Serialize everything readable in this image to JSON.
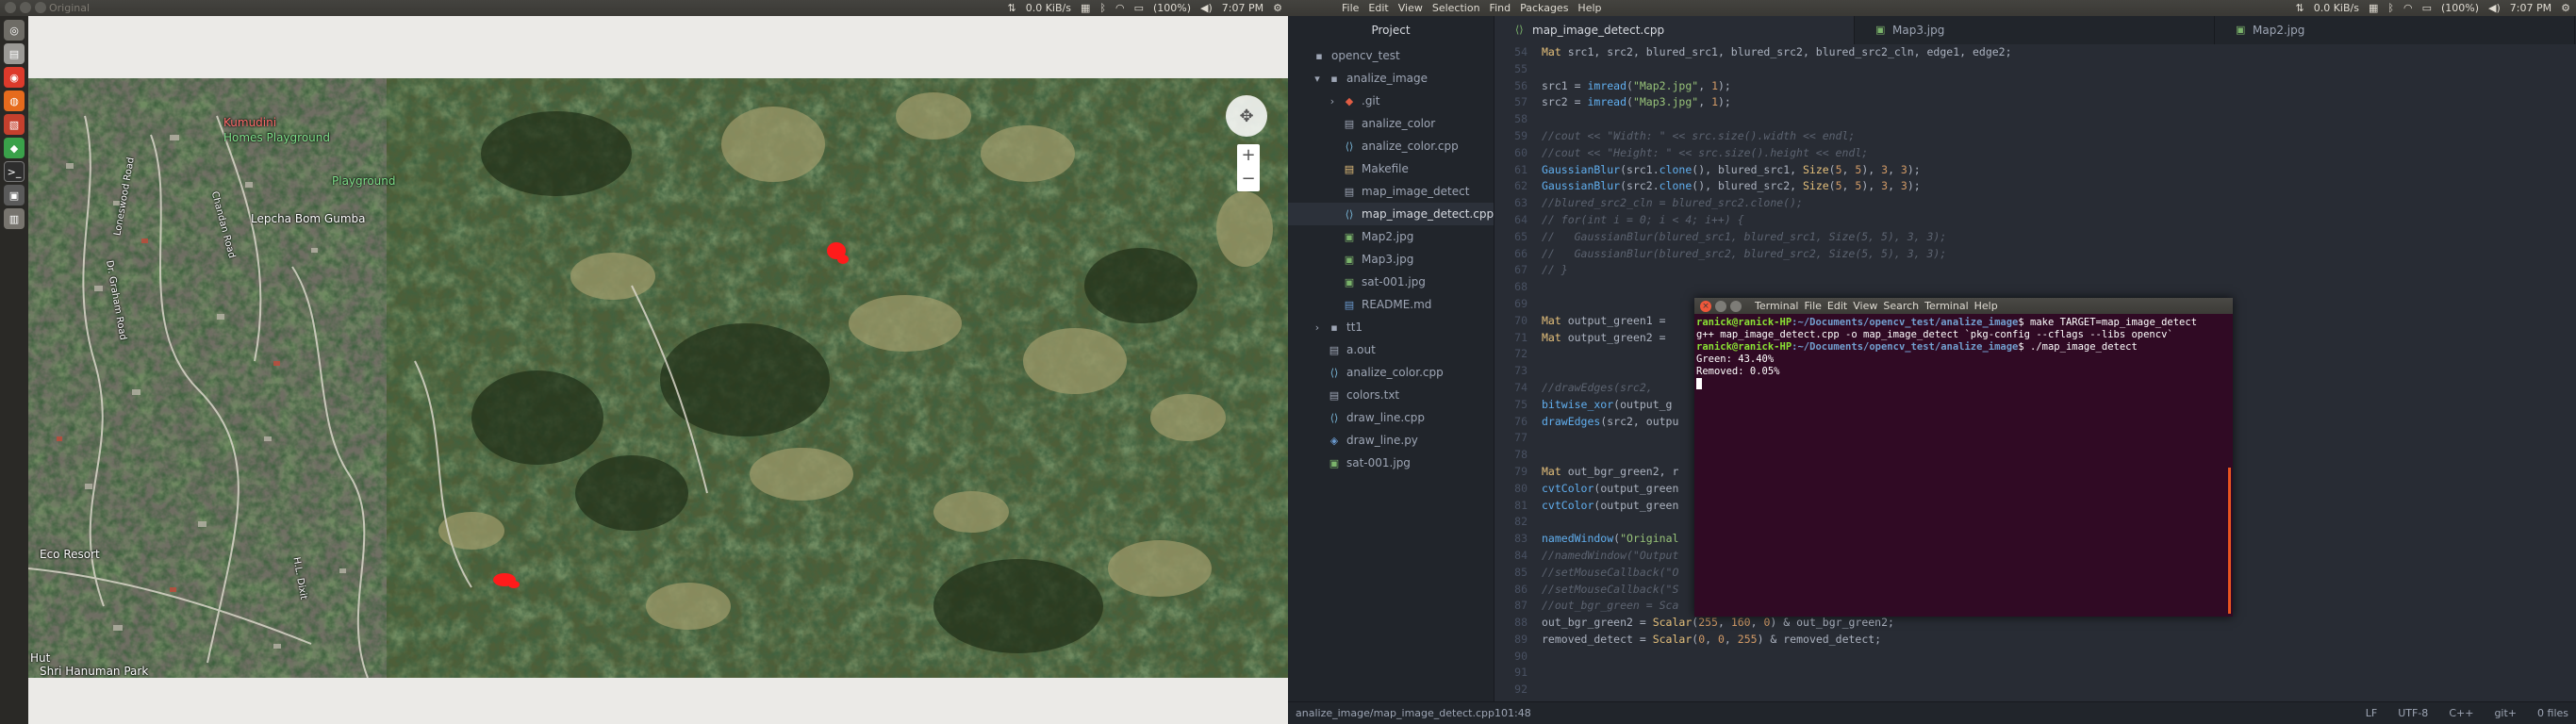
{
  "left_panel": {
    "title": "Original",
    "indicators": {
      "net": "0.0 KiB/s",
      "battery": "(100%)",
      "time": "7:07 PM"
    }
  },
  "right_panel": {
    "menu": [
      "File",
      "Edit",
      "View",
      "Selection",
      "Find",
      "Packages",
      "Help"
    ],
    "indicators": {
      "net": "0.0 KiB/s",
      "battery": "(100%)",
      "time": "7:07 PM"
    }
  },
  "map": {
    "labels": {
      "kumudini": "Kumudini",
      "kumudini2": "Homes Playground",
      "playground": "Playground",
      "lepcha": "Lepcha Bom Gumba",
      "eco_resort": "Eco Resort",
      "hanuman": "Shri Hanuman Park",
      "hut": "Hut",
      "road1": "Dr. Graham Road",
      "road2": "Chandan Road",
      "road3": "Loneswood Road",
      "road4": "H.L. Dixit"
    },
    "zoom_in": "+",
    "zoom_out": "−"
  },
  "editor": {
    "tree_header": "Project",
    "tree": [
      {
        "label": "opencv_test",
        "icon": "folder-icon",
        "indent": 0,
        "arrow": ""
      },
      {
        "label": "analize_image",
        "icon": "folder-icon",
        "indent": 1,
        "arrow": "▾"
      },
      {
        "label": ".git",
        "icon": "git-icon",
        "indent": 2,
        "arrow": "›"
      },
      {
        "label": "analize_color",
        "icon": "binary-icon",
        "indent": 2,
        "arrow": ""
      },
      {
        "label": "analize_color.cpp",
        "icon": "cpp-icon",
        "indent": 2,
        "arrow": ""
      },
      {
        "label": "Makefile",
        "icon": "makefile-icon",
        "indent": 2,
        "arrow": ""
      },
      {
        "label": "map_image_detect",
        "icon": "binary-icon",
        "indent": 2,
        "arrow": ""
      },
      {
        "label": "map_image_detect.cpp",
        "icon": "cpp-icon",
        "indent": 2,
        "arrow": "",
        "selected": true
      },
      {
        "label": "Map2.jpg",
        "icon": "image-icon",
        "indent": 2,
        "arrow": ""
      },
      {
        "label": "Map3.jpg",
        "icon": "image-icon",
        "indent": 2,
        "arrow": ""
      },
      {
        "label": "sat-001.jpg",
        "icon": "image-icon",
        "indent": 2,
        "arrow": ""
      },
      {
        "label": "README.md",
        "icon": "markdown-icon",
        "indent": 2,
        "arrow": ""
      },
      {
        "label": "tt1",
        "icon": "folder-icon",
        "indent": 1,
        "arrow": "›"
      },
      {
        "label": "a.out",
        "icon": "binary-icon",
        "indent": 1,
        "arrow": ""
      },
      {
        "label": "analize_color.cpp",
        "icon": "cpp-icon",
        "indent": 1,
        "arrow": ""
      },
      {
        "label": "colors.txt",
        "icon": "text-icon",
        "indent": 1,
        "arrow": ""
      },
      {
        "label": "draw_line.cpp",
        "icon": "cpp-icon",
        "indent": 1,
        "arrow": ""
      },
      {
        "label": "draw_line.py",
        "icon": "python-icon",
        "indent": 1,
        "arrow": ""
      },
      {
        "label": "sat-001.jpg",
        "icon": "image-icon",
        "indent": 1,
        "arrow": ""
      }
    ],
    "tabs": [
      {
        "label": "map_image_detect.cpp",
        "active": true
      },
      {
        "label": "Map3.jpg",
        "active": false
      },
      {
        "label": "Map2.jpg",
        "active": false
      }
    ],
    "status": {
      "path": "analize_image/map_image_detect.cpp",
      "cursor": "101:48",
      "line_ending": "LF",
      "encoding": "UTF-8",
      "grammar": "C++",
      "git": "git+",
      "files": "0 files"
    }
  },
  "terminal": {
    "title": "Terminal",
    "menu": [
      "File",
      "Edit",
      "View",
      "Search",
      "Terminal",
      "Help"
    ],
    "lines": [
      {
        "prompt_user": "ranick@ranick-HP",
        "prompt_path": ":~/Documents/opencv_test/analize_image",
        "cmd": "$ make TARGET=map_image_detect"
      },
      {
        "text": "g++ map_image_detect.cpp -o map_image_detect `pkg-config --cflags --libs opencv`"
      },
      {
        "prompt_user": "ranick@ranick-HP",
        "prompt_path": ":~/Documents/opencv_test/analize_image",
        "cmd": "$ ./map_image_detect"
      },
      {
        "text": "Green: 43.40%"
      },
      {
        "text": "Removed: 0.05%"
      }
    ]
  }
}
